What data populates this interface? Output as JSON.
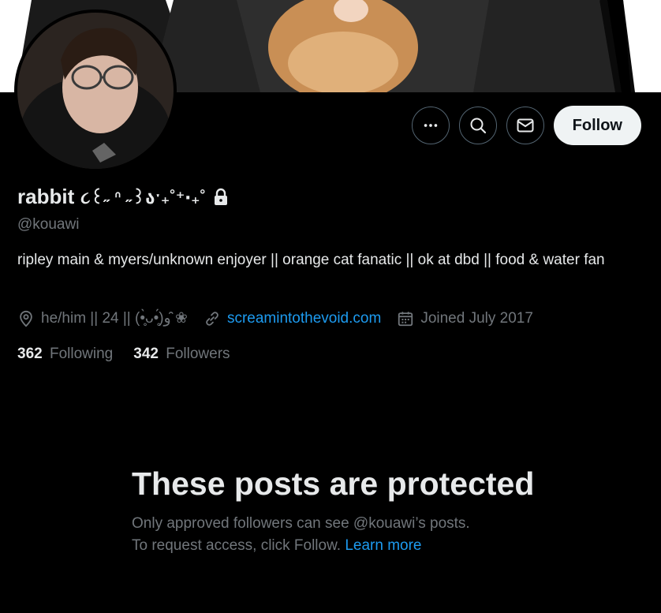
{
  "profile": {
    "display_name": "rabbit",
    "name_decoration": "૮꒰˶ ᐢ ˶꒱აˑ₊˚⁺‧₊˚",
    "handle": "@kouawi",
    "bio": "ripley main & myers/unknown enjoyer || orange cat fanatic || ok at dbd || food & water fan",
    "location": "he/him || 24 || (•̥̀ᴗ•̥́)و ̑̑❀",
    "website": "screamintothevoid.com",
    "joined": "Joined July 2017",
    "following_count": "362",
    "following_label": "Following",
    "followers_count": "342",
    "followers_label": "Followers"
  },
  "actions": {
    "more_icon": "more-icon",
    "search_icon": "search-icon",
    "message_icon": "mail-icon",
    "follow_label": "Follow"
  },
  "protected": {
    "title": "These posts are protected",
    "line1": "Only approved followers can see @kouawi’s posts.",
    "line2": "To request access, click Follow.",
    "learn_more": "Learn more"
  },
  "colors": {
    "background": "#000000",
    "text": "#e7e9ea",
    "muted": "#71767b",
    "accent": "#1d9bf0",
    "follow_bg": "#eff3f4"
  }
}
